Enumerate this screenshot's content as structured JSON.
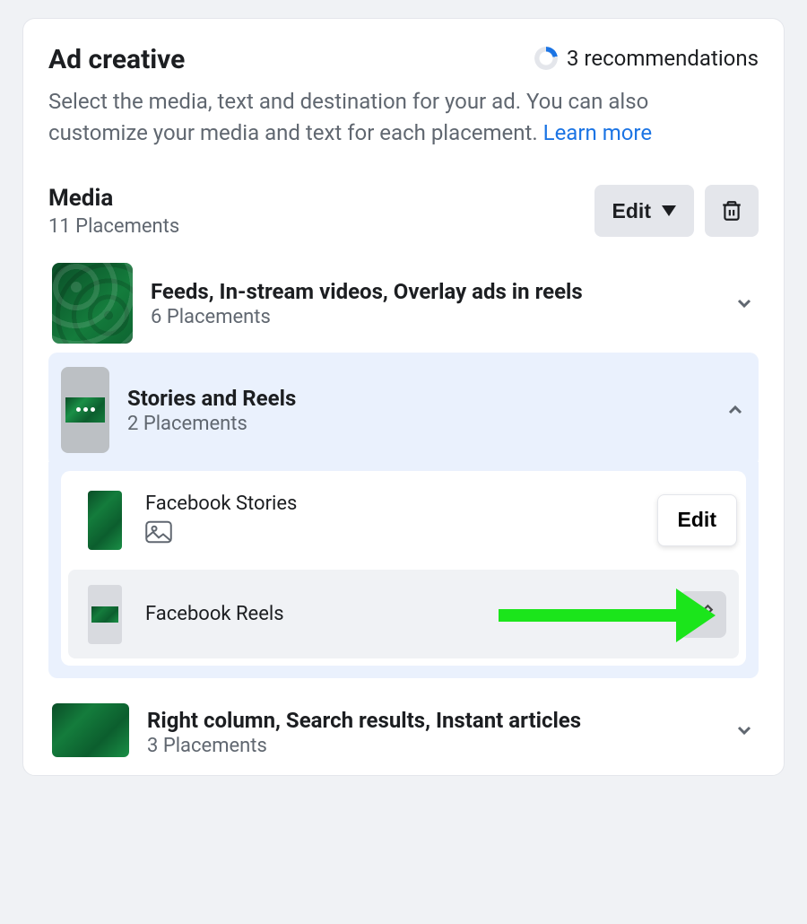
{
  "header": {
    "title": "Ad creative",
    "recommendations": "3 recommendations",
    "description_prefix": "Select the media, text and destination for your ad. You can also customize your media and text for each placement. ",
    "learn_more": "Learn more"
  },
  "media": {
    "title": "Media",
    "placements_count": "11 Placements",
    "edit_label": "Edit"
  },
  "groups": {
    "feeds": {
      "title": "Feeds, In-stream videos, Overlay ads in reels",
      "sub": "6 Placements"
    },
    "stories": {
      "title": "Stories and Reels",
      "sub": "2 Placements",
      "items": {
        "fb_stories": "Facebook Stories",
        "fb_reels": "Facebook Reels",
        "edit_label": "Edit"
      }
    },
    "right_col": {
      "title": "Right column, Search results, Instant articles",
      "sub": "3 Placements"
    }
  }
}
